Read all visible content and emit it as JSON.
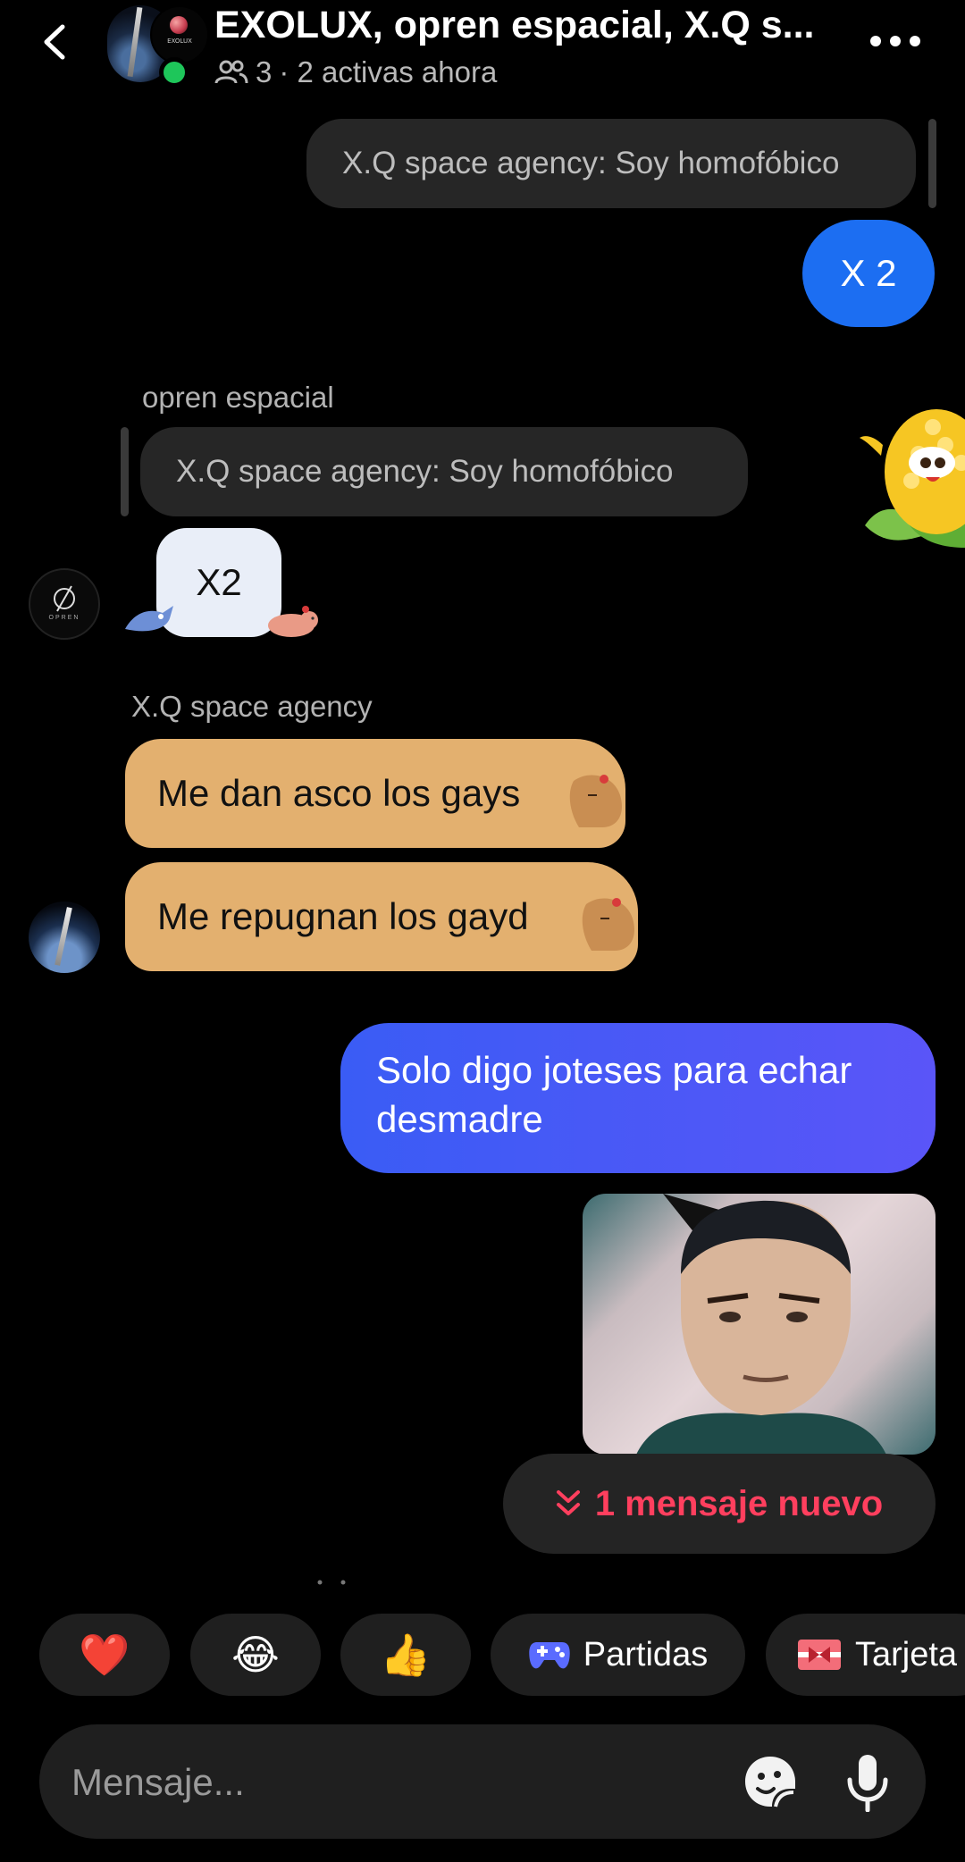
{
  "header": {
    "title": "EXOLUX, opren espacial, X.Q s...",
    "member_count": "3",
    "active_text": "· 2 activas ahora",
    "avatar_logo_text": "EXOLUX"
  },
  "messages": {
    "quote1": "X.Q space agency: Soy homofóbico",
    "mine1": "X 2",
    "sender_opren": "opren espacial",
    "quote2": "X.Q space agency: Soy homofóbico",
    "opren_msg": "X2",
    "opren_avatar_text": "OPREN",
    "sender_xq": "X.Q space agency",
    "xq_msg1": "Me dan asco los gays",
    "xq_msg2": "Me repugnan los gayd",
    "mine2": "Solo digo joteses para echar desmadre"
  },
  "new_messages": {
    "label": "1 mensaje nuevo"
  },
  "quick_chips": [
    {
      "icon": "heart-emoji",
      "glyph": "❤️"
    },
    {
      "icon": "laughing-emoji",
      "glyph": "😂"
    },
    {
      "icon": "thumbs-up-emoji",
      "glyph": "👍"
    },
    {
      "icon": "gamepad-icon",
      "label": "Partidas"
    },
    {
      "icon": "gift-icon",
      "label": "Tarjeta"
    }
  ],
  "composer": {
    "placeholder": "Mensaje..."
  },
  "colors": {
    "accent_blue": "#1c6ef2",
    "gradient_start": "#3a5cf5",
    "gradient_end": "#5a55f8",
    "new_message_red": "#ff3f5e",
    "online_green": "#1ec65a",
    "tan_bubble": "#e3b06f"
  }
}
